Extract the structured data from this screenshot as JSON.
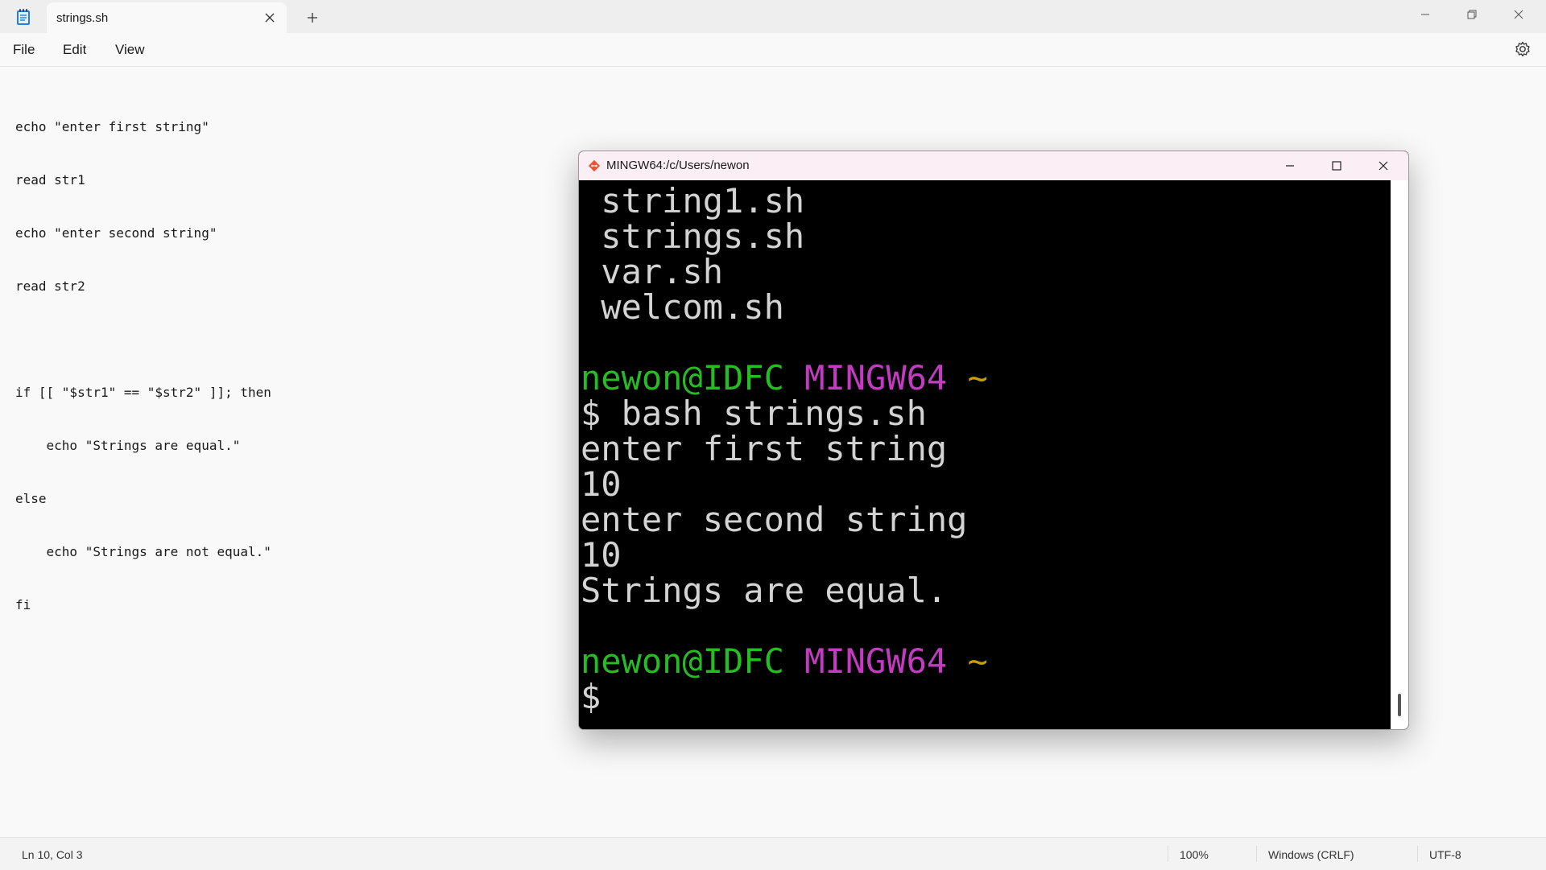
{
  "notepad": {
    "tab_title": "strings.sh",
    "menu": [
      "File",
      "Edit",
      "View"
    ],
    "code_lines": [
      "echo \"enter first string\"",
      "read str1",
      "echo \"enter second string\"",
      "read str2",
      "",
      "if [[ \"$str1\" == \"$str2\" ]]; then",
      "    echo \"Strings are equal.\"",
      "else",
      "    echo \"Strings are not equal.\"",
      "fi"
    ],
    "status": {
      "position": "Ln 10, Col 3",
      "zoom": "100%",
      "line_ending": "Windows (CRLF)",
      "encoding": "UTF-8"
    }
  },
  "terminal": {
    "title": "MINGW64:/c/Users/newon",
    "prompt": {
      "user": "newon@IDFC",
      "system": "MINGW64",
      "path": "~",
      "symbol": "$"
    },
    "lines": [
      {
        "kind": "text",
        "text": " string1.sh"
      },
      {
        "kind": "text",
        "text": " strings.sh"
      },
      {
        "kind": "text",
        "text": " var.sh"
      },
      {
        "kind": "text",
        "text": " welcom.sh"
      },
      {
        "kind": "text",
        "text": ""
      },
      {
        "kind": "prompt"
      },
      {
        "kind": "text",
        "text": "$ bash strings.sh"
      },
      {
        "kind": "text",
        "text": "enter first string"
      },
      {
        "kind": "text",
        "text": "10"
      },
      {
        "kind": "text",
        "text": "enter second string"
      },
      {
        "kind": "text",
        "text": "10"
      },
      {
        "kind": "text",
        "text": "Strings are equal."
      },
      {
        "kind": "text",
        "text": ""
      },
      {
        "kind": "prompt"
      },
      {
        "kind": "text",
        "text": "$"
      }
    ]
  },
  "colors": {
    "prompt_user": "#25bc24",
    "prompt_system": "#c43ac3",
    "prompt_path": "#c7a000",
    "terminal_text": "#d3d3d3",
    "terminal_bg": "#000000"
  }
}
